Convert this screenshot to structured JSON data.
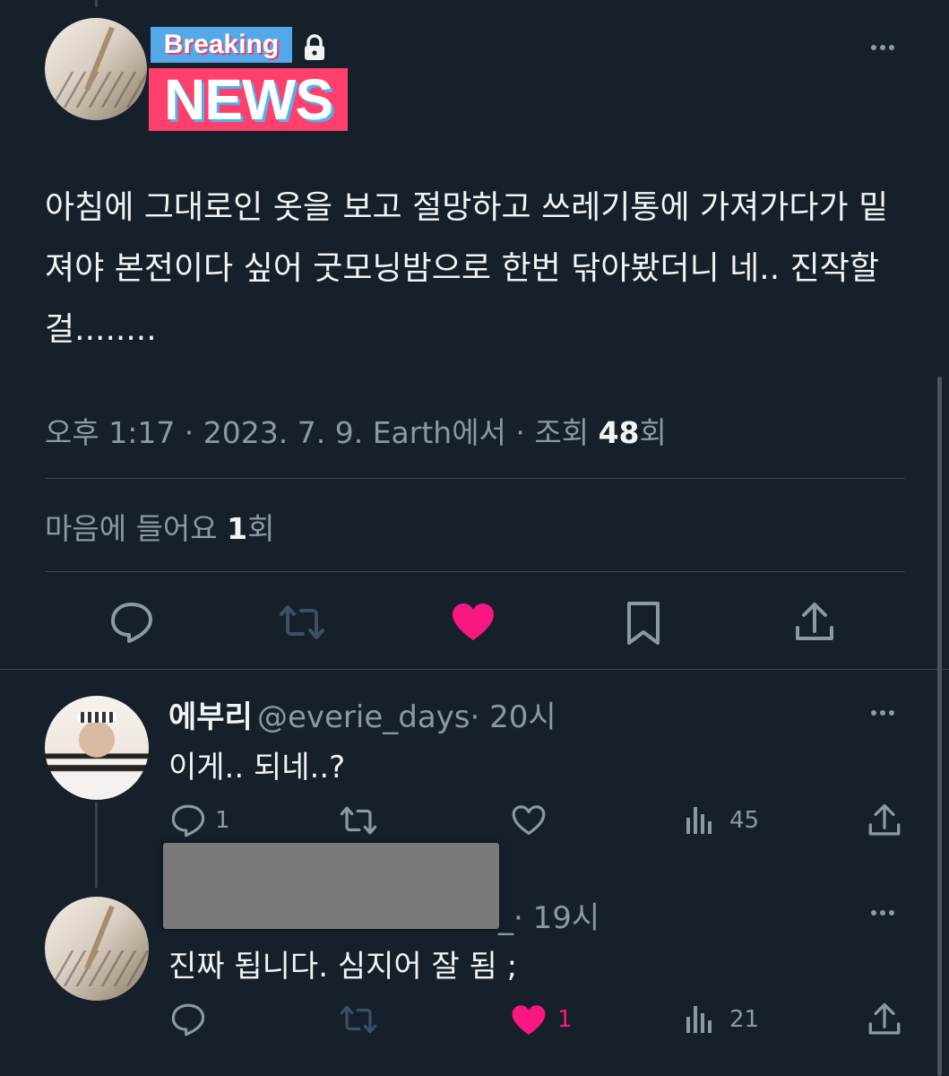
{
  "main_tweet": {
    "badge_top": "Breaking",
    "badge_bottom": "NEWS",
    "text": "아침에 그대로인 옷을 보고 절망하고 쓰레기통에 가져가다가 밑져야 본전이다 싶어 굿모닝밤으로 한번 닦아봤더니 네.. 진작할걸........",
    "meta_time": "오후 1:17 · 2023. 7. 9. Earth에서 · 조회 ",
    "meta_views": "48",
    "meta_views_suffix": "회",
    "likes_prefix": "마음에 들어요 ",
    "likes_count": "1",
    "likes_suffix": "회",
    "liked_color": "#f91880"
  },
  "replies": [
    {
      "name": "에부리",
      "handle": "@everie_days",
      "time": "· 20시",
      "text": "이게.. 되네..?",
      "reply_count": "1",
      "view_count": "45"
    },
    {
      "name": "",
      "handle": "_",
      "time": "· 19시",
      "text": "진짜 됩니다. 심지어 잘 됨 ;",
      "like_count": "1",
      "view_count": "21"
    }
  ],
  "icons": [
    "reply-icon",
    "retweet-icon",
    "like-icon",
    "bookmark-icon",
    "share-icon",
    "views-icon",
    "more-icon",
    "lock-icon"
  ]
}
